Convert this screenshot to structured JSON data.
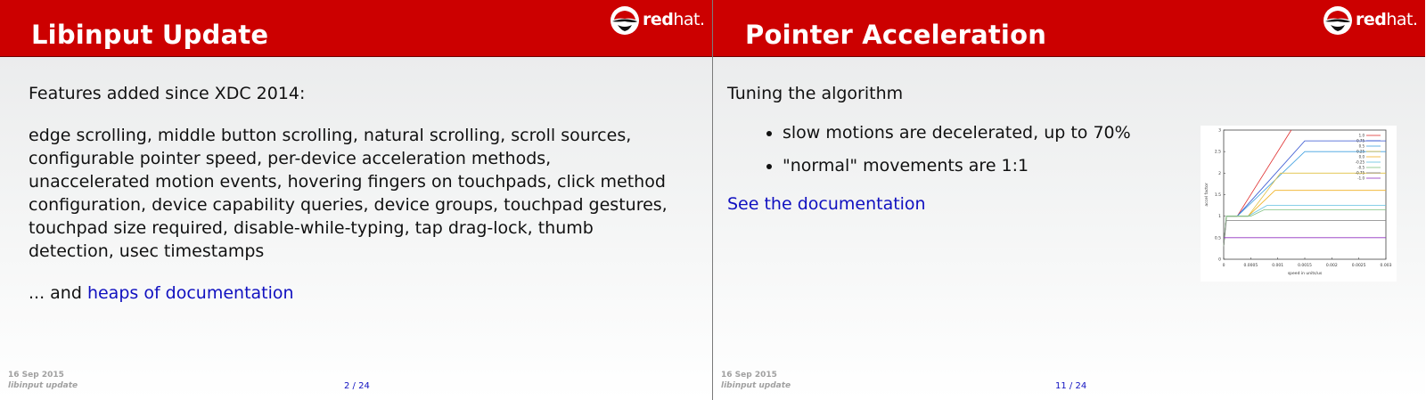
{
  "logo": {
    "bold": "red",
    "thin": "hat",
    "suffix": "."
  },
  "left": {
    "title": "Libinput Update",
    "intro": "Features added since XDC 2014:",
    "features": "edge scrolling, middle button scrolling, natural scrolling, scroll sources, configurable pointer speed, per-device acceleration methods, unaccelerated motion events, hovering fingers on touchpads, click method configuration, device capability queries, device groups, touchpad gestures, touchpad size required, disable-while-typing, tap drag-lock, thumb detection, usec timestamps",
    "and_prefix": "... and ",
    "docs_link": "heaps of documentation",
    "footer_date": "16 Sep 2015",
    "footer_sub": "libinput update",
    "page": "2 / 24"
  },
  "right": {
    "title": "Pointer Acceleration",
    "intro": "Tuning the algorithm",
    "bullets": [
      "slow motions are decelerated, up to 70%",
      "\"normal\" movements are 1:1"
    ],
    "docs_link": "See the documentation",
    "footer_date": "16 Sep 2015",
    "footer_sub": "libinput update",
    "page": "11 / 24"
  },
  "chart_data": {
    "type": "line",
    "xlabel": "speed in units/us",
    "ylabel": "accel factor",
    "xlim": [
      0,
      0.003
    ],
    "ylim": [
      0,
      3
    ],
    "x_ticks": [
      "0",
      "0.0005",
      "0.001",
      "0.0015",
      "0.002",
      "0.0025",
      "0.003"
    ],
    "y_ticks": [
      "0",
      "0.5",
      "1",
      "1.5",
      "2",
      "2.5",
      "3"
    ],
    "legend_position": "top-right",
    "series": [
      {
        "name": "1.0",
        "color": "#e03030",
        "points": [
          [
            0,
            0.3
          ],
          [
            5e-05,
            1.0
          ],
          [
            0.00025,
            1.0
          ],
          [
            0.00125,
            3.0
          ]
        ]
      },
      {
        "name": "0.75",
        "color": "#3050d0",
        "points": [
          [
            0,
            0.3
          ],
          [
            5e-05,
            1.0
          ],
          [
            0.00025,
            1.0
          ],
          [
            0.0015,
            2.75
          ],
          [
            0.003,
            2.75
          ]
        ]
      },
      {
        "name": "0.5",
        "color": "#40a0e0",
        "points": [
          [
            0,
            0.3
          ],
          [
            5e-05,
            1.0
          ],
          [
            0.00025,
            1.0
          ],
          [
            0.0015,
            2.5
          ],
          [
            0.003,
            2.5
          ]
        ]
      },
      {
        "name": "0.25",
        "color": "#e0c040",
        "points": [
          [
            0,
            0.3
          ],
          [
            5e-05,
            1.0
          ],
          [
            0.00045,
            1.0
          ],
          [
            0.00105,
            2.0
          ],
          [
            0.003,
            2.0
          ]
        ]
      },
      {
        "name": "0.0",
        "color": "#f0b020",
        "points": [
          [
            0,
            0.3
          ],
          [
            5e-05,
            1.0
          ],
          [
            0.00045,
            1.0
          ],
          [
            0.00095,
            1.6
          ],
          [
            0.003,
            1.6
          ]
        ]
      },
      {
        "name": "-0.25",
        "color": "#60c0e0",
        "points": [
          [
            0,
            0.3
          ],
          [
            5e-05,
            1.0
          ],
          [
            0.00045,
            1.0
          ],
          [
            0.0008,
            1.25
          ],
          [
            0.003,
            1.25
          ]
        ]
      },
      {
        "name": "-0.5",
        "color": "#80c080",
        "points": [
          [
            0,
            0.3
          ],
          [
            5e-05,
            1.0
          ],
          [
            0.0005,
            1.0
          ],
          [
            0.00075,
            1.15
          ],
          [
            0.003,
            1.15
          ]
        ]
      },
      {
        "name": "-0.75",
        "color": "#808080",
        "points": [
          [
            0,
            0.3
          ],
          [
            5e-05,
            0.9
          ],
          [
            0.003,
            0.9
          ]
        ]
      },
      {
        "name": "-1.0",
        "color": "#9030c0",
        "points": [
          [
            0,
            0.5
          ],
          [
            0.003,
            0.5
          ]
        ]
      }
    ]
  }
}
